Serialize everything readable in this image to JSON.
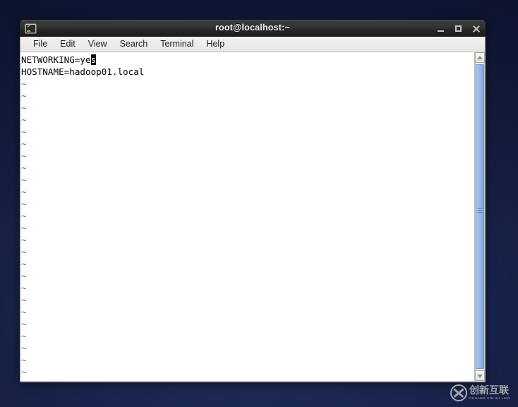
{
  "desktop": {
    "background_color": "#141d3f"
  },
  "window": {
    "title": "root@localhost:~",
    "icon": "terminal-icon",
    "controls": {
      "minimize": "_",
      "maximize": "□",
      "close": "✕"
    },
    "menubar": {
      "items": [
        {
          "label": "File"
        },
        {
          "label": "Edit"
        },
        {
          "label": "View"
        },
        {
          "label": "Search"
        },
        {
          "label": "Terminal"
        },
        {
          "label": "Help"
        }
      ]
    },
    "terminal": {
      "foreground_color": "#000000",
      "background_color": "#ffffff",
      "tilde_color": "#4a6fd4",
      "cursor_color": "#000000",
      "lines": [
        {
          "text": "NETWORKING=yes",
          "type": "text",
          "cursor_at": 13
        },
        {
          "text": "HOSTNAME=hadoop01.local",
          "type": "text",
          "cursor_at": -1
        }
      ],
      "empty_marker": "~",
      "empty_line_count": 25
    },
    "scrollbar": {
      "up_arrow": "▲",
      "down_arrow": "▼",
      "thumb_color": "#8fb1e6"
    }
  },
  "watermark": {
    "chinese": "创新互联",
    "pinyin": "CHUANG XIN HU LIAN"
  }
}
